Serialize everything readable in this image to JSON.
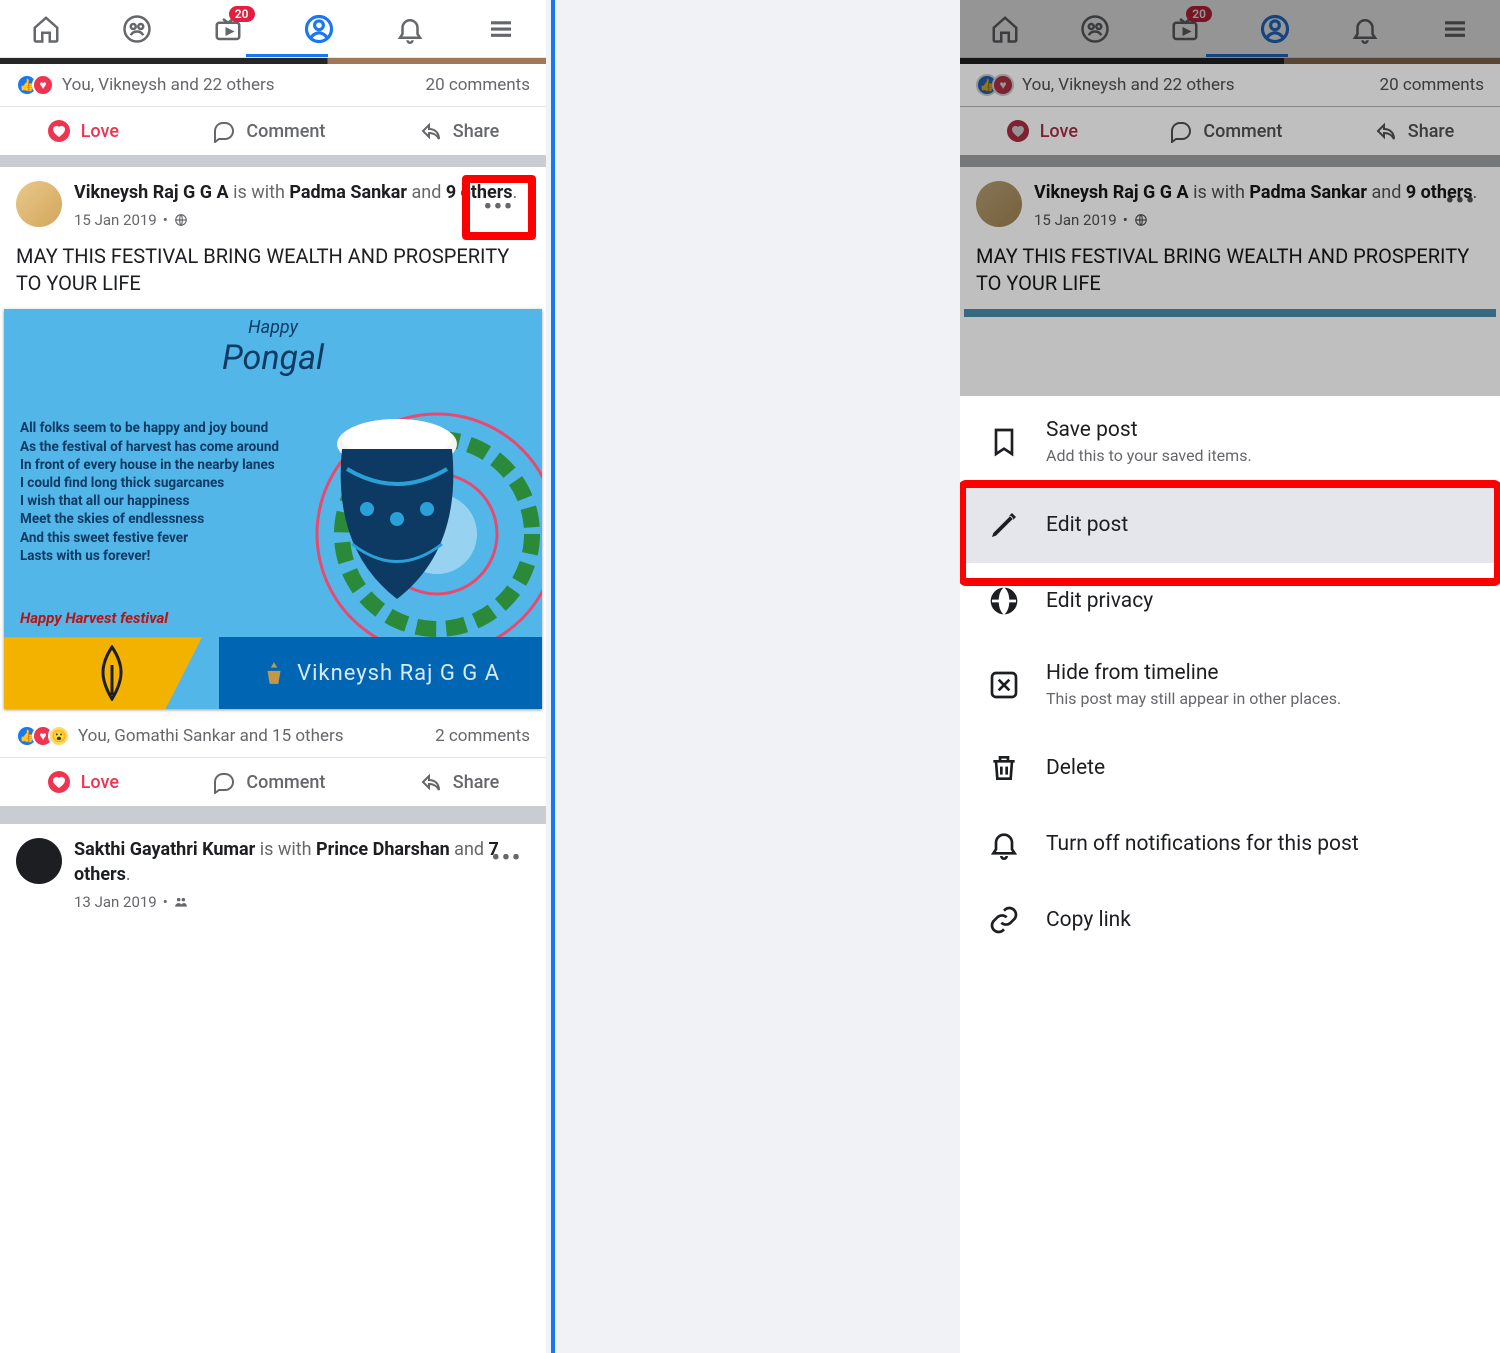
{
  "tabs": {
    "badge": "20"
  },
  "post1_reactions": {
    "text": "You, Vikneysh and 22 others",
    "comments": "20 comments"
  },
  "actions": {
    "love": "Love",
    "comment": "Comment",
    "share": "Share"
  },
  "post2": {
    "author": "Vikneysh Raj G G A",
    "is_with": "is with",
    "tagged": "Padma Sankar",
    "and": "and",
    "others": "9 others",
    "date": "15 Jan 2019",
    "dot": "•",
    "text": "MAY THIS FESTIVAL BRING WEALTH AND PROSPERITY TO YOUR LIFE",
    "reactions_text": "You, Gomathi Sankar and 15 others",
    "comments": "2 comments"
  },
  "pongal": {
    "happy": "Happy",
    "title": "Pongal",
    "poem_lines": [
      "All folks seem to be happy and joy bound",
      "As the festival of harvest has come around",
      "In front of every house in the nearby lanes",
      "I could find long thick sugarcanes",
      "I wish that all our happiness",
      "Meet the skies of endlessness",
      "And this sweet  festive fever",
      "Lasts with us forever!"
    ],
    "wish": "Happy Harvest festival",
    "signature": "Vikneysh Raj G G A"
  },
  "post3": {
    "author": "Sakthi Gayathri Kumar",
    "is_with": "is with",
    "tagged": "Prince Dharshan",
    "and": "and",
    "others": "7 others",
    "date": "13 Jan 2019",
    "dot": "•"
  },
  "sheet": {
    "save": {
      "title": "Save post",
      "sub": "Add this to your saved items."
    },
    "edit": {
      "title": "Edit post"
    },
    "privacy": {
      "title": "Edit privacy"
    },
    "hide": {
      "title": "Hide from timeline",
      "sub": "This post may still appear in other places."
    },
    "delete": {
      "title": "Delete"
    },
    "notif": {
      "title": "Turn off notifications for this post"
    },
    "copy": {
      "title": "Copy link"
    }
  }
}
